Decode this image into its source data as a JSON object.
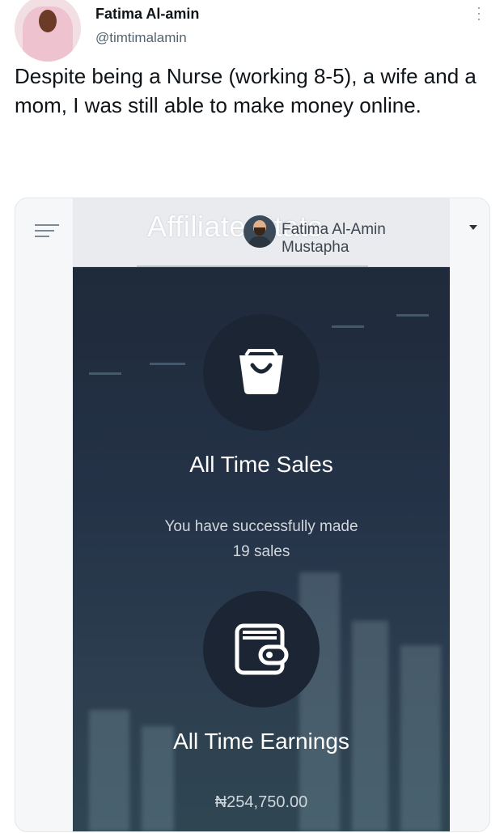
{
  "tweet": {
    "author_name": "Fatima Al-amin",
    "author_handle": "@timtimalamin",
    "text": "Despite being a Nurse (working 8-5), a wife and a mom, I was still able to make money online."
  },
  "app": {
    "header_title": "Affiliate Stats",
    "user_name": "Fatima Al-Amin Mustapha",
    "icons": [
      "menu-icon",
      "caret-down-icon",
      "shopping-bag-icon",
      "wallet-icon"
    ],
    "sales": {
      "title": "All Time Sales",
      "line1": "You have successfully made",
      "line2": "19 sales"
    },
    "earnings": {
      "title": "All Time Earnings",
      "amount": "₦254,750.00"
    }
  },
  "colors": {
    "panel": "#243247",
    "circle": "#1b2533",
    "header": "#e9ebee"
  }
}
